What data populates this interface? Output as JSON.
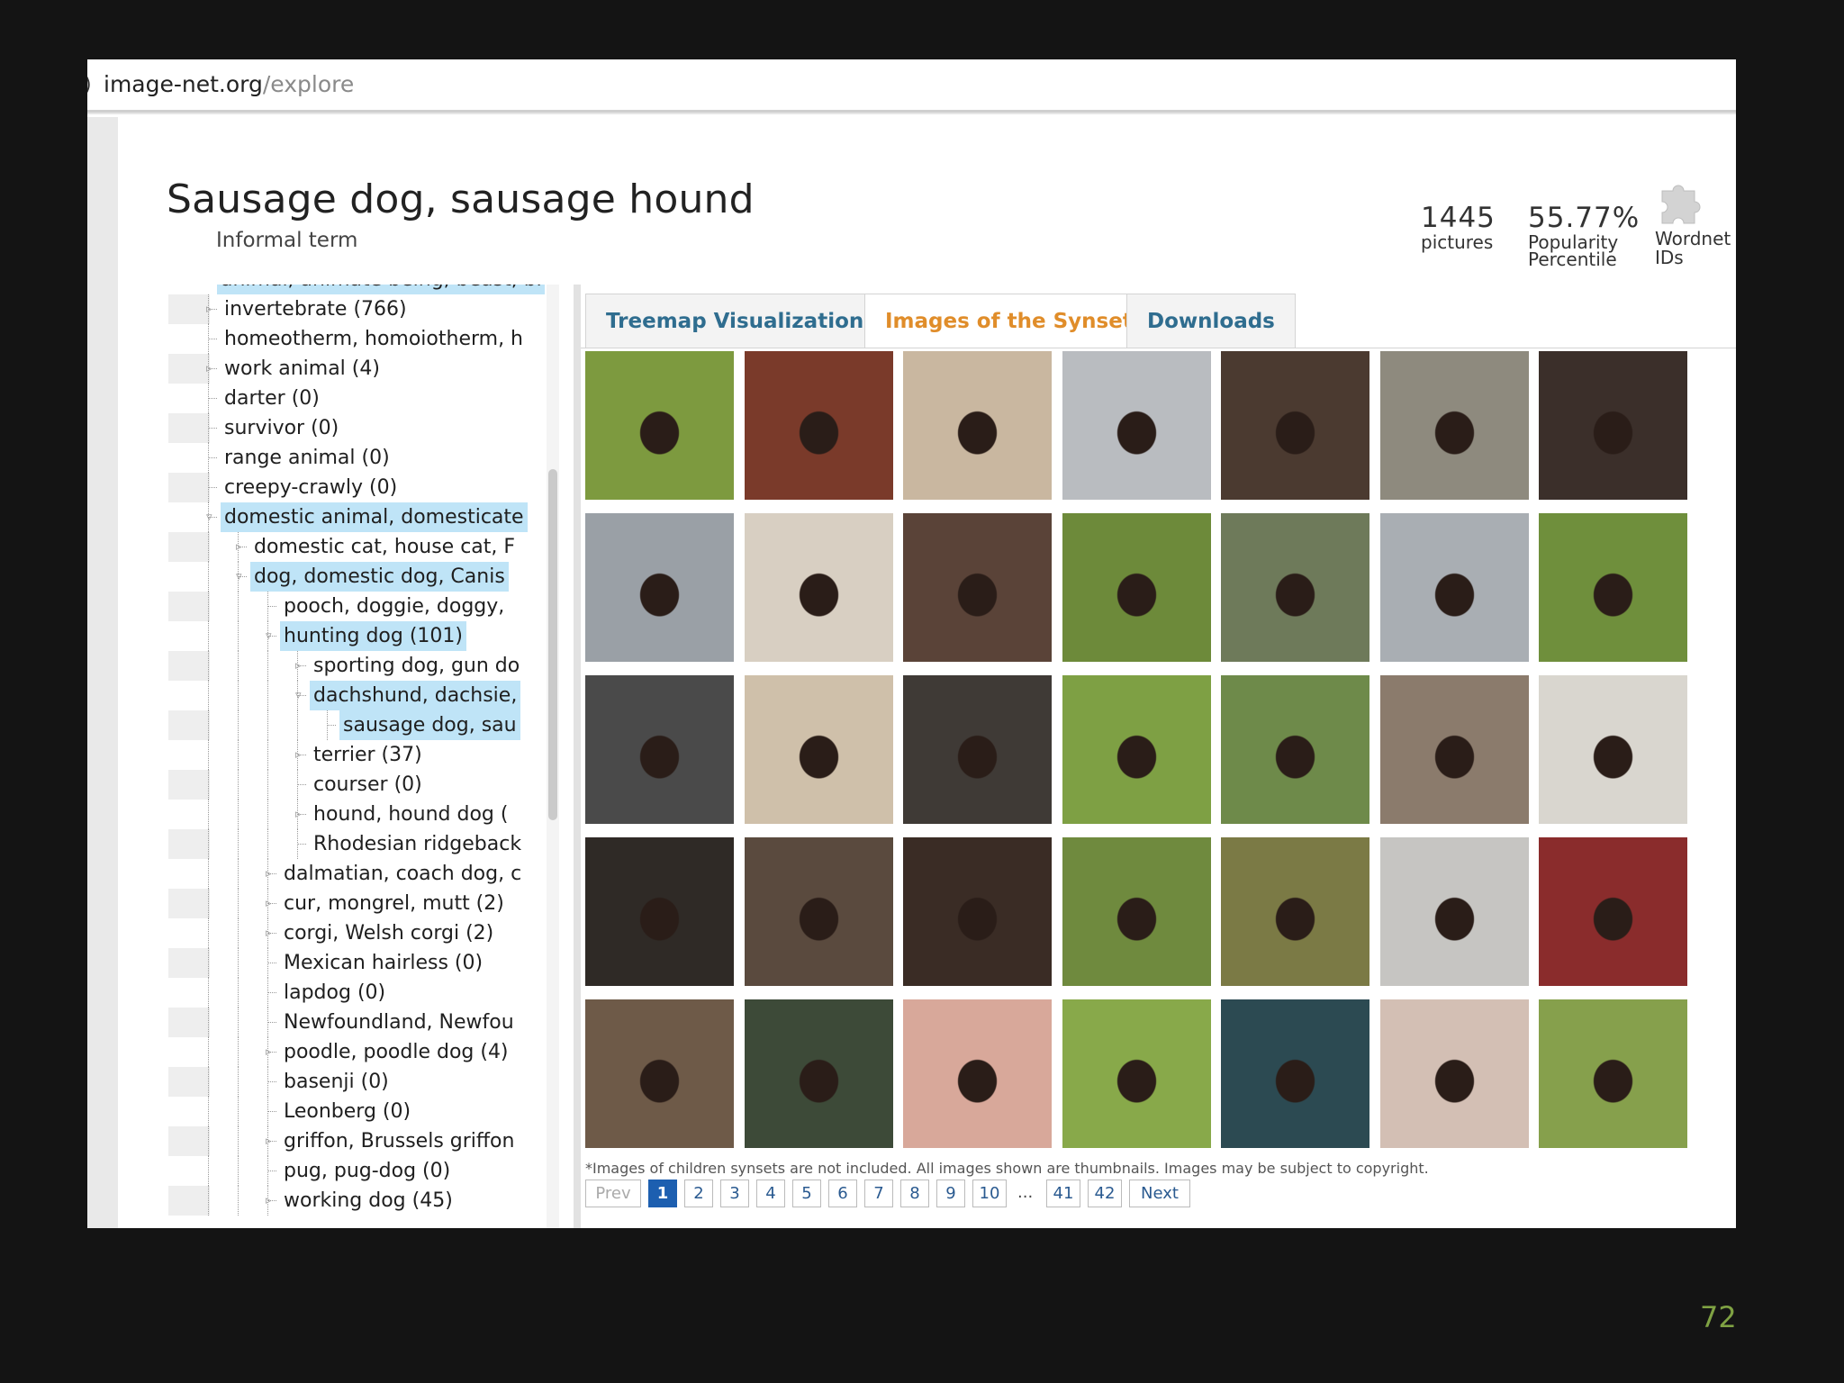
{
  "browser": {
    "url_domain": "image-net.org",
    "url_path": "/explore"
  },
  "synset": {
    "title": "Sausage dog, sausage hound",
    "subtitle": "Informal term",
    "pictures_count": "1445",
    "pictures_label": "pictures",
    "popularity": "55.77%",
    "popularity_label_1": "Popularity",
    "popularity_label_2": "Percentile",
    "wordnet_label_1": "Wordnet",
    "wordnet_label_2": "IDs"
  },
  "tree": {
    "top_partial": "animal, animate being, beast, bru",
    "items": [
      {
        "label": "invertebrate (766)",
        "level": 1,
        "expandable": true
      },
      {
        "label": "homeotherm, homoiotherm, h",
        "level": 1
      },
      {
        "label": "work animal (4)",
        "level": 1,
        "expandable": true
      },
      {
        "label": "darter (0)",
        "level": 1
      },
      {
        "label": "survivor (0)",
        "level": 1
      },
      {
        "label": "range animal (0)",
        "level": 1
      },
      {
        "label": "creepy-crawly (0)",
        "level": 1
      },
      {
        "label": "domestic animal, domesticate",
        "level": 1,
        "expandable": true,
        "highlight": true
      },
      {
        "label": "domestic cat, house cat, F",
        "level": 2,
        "expandable": true
      },
      {
        "label": "dog, domestic dog, Canis",
        "level": 2,
        "expandable": true,
        "highlight": true
      },
      {
        "label": "pooch, doggie, doggy,",
        "level": 3
      },
      {
        "label": "hunting dog (101)",
        "level": 3,
        "expandable": true,
        "highlight": true
      },
      {
        "label": "sporting dog, gun do",
        "level": 4,
        "expandable": true
      },
      {
        "label": "dachshund, dachsie,",
        "level": 4,
        "expandable": true,
        "highlight": true
      },
      {
        "label": "sausage dog, sau",
        "level": 5,
        "highlight": true
      },
      {
        "label": "terrier (37)",
        "level": 4,
        "expandable": true
      },
      {
        "label": "courser (0)",
        "level": 4
      },
      {
        "label": "hound, hound dog (",
        "level": 4,
        "expandable": true
      },
      {
        "label": "Rhodesian ridgeback",
        "level": 4
      },
      {
        "label": "dalmatian, coach dog, c",
        "level": 3,
        "expandable": true
      },
      {
        "label": "cur, mongrel, mutt (2)",
        "level": 3,
        "expandable": true
      },
      {
        "label": "corgi, Welsh corgi (2)",
        "level": 3,
        "expandable": true
      },
      {
        "label": "Mexican hairless (0)",
        "level": 3
      },
      {
        "label": "lapdog (0)",
        "level": 3
      },
      {
        "label": "Newfoundland, Newfou",
        "level": 3
      },
      {
        "label": "poodle, poodle dog (4)",
        "level": 3,
        "expandable": true
      },
      {
        "label": "basenji (0)",
        "level": 3
      },
      {
        "label": "Leonberg (0)",
        "level": 3
      },
      {
        "label": "griffon, Brussels griffon",
        "level": 3,
        "expandable": true
      },
      {
        "label": "pug, pug-dog (0)",
        "level": 3
      },
      {
        "label": "working dog (45)",
        "level": 3,
        "expandable": true
      }
    ]
  },
  "tabs": [
    {
      "label": "Treemap Visualization",
      "active": false
    },
    {
      "label": "Images of the Synset",
      "active": true
    },
    {
      "label": "Downloads",
      "active": false
    }
  ],
  "thumbnails": {
    "rows": 5,
    "cols": 7,
    "colors": [
      [
        "#7d9a3f",
        "#7a3a2a",
        "#c9b7a0",
        "#b9bcc0",
        "#4b3a30",
        "#8e8a7e",
        "#3b2f2a"
      ],
      [
        "#9aa0a6",
        "#d8cfc2",
        "#5a4338",
        "#6d8a3a",
        "#6e7a5a",
        "#a9aeb3",
        "#6f8f3c"
      ],
      [
        "#4a4a4a",
        "#cfc0aa",
        "#3f3a36",
        "#7ea044",
        "#6e8a4a",
        "#8b7b6c",
        "#d9d6cf"
      ],
      [
        "#2f2a26",
        "#5a4a3e",
        "#3a2c25",
        "#6f8a3e",
        "#7b7a45",
        "#c6c5c2",
        "#8a2c2c"
      ],
      [
        "#6e5a48",
        "#3d4a38",
        "#d8a89a",
        "#88a94a",
        "#2c4a52",
        "#d3bfb4",
        "#86a04c"
      ]
    ],
    "footnote": "*Images of children synsets are not included. All images shown are thumbnails. Images may be subject to copyright."
  },
  "pagination": {
    "prev": "Prev",
    "pages": [
      "1",
      "2",
      "3",
      "4",
      "5",
      "6",
      "7",
      "8",
      "9",
      "10"
    ],
    "ellipsis": "...",
    "last_pages": [
      "41",
      "42"
    ],
    "next": "Next",
    "current": "1"
  },
  "slide_number": "72"
}
